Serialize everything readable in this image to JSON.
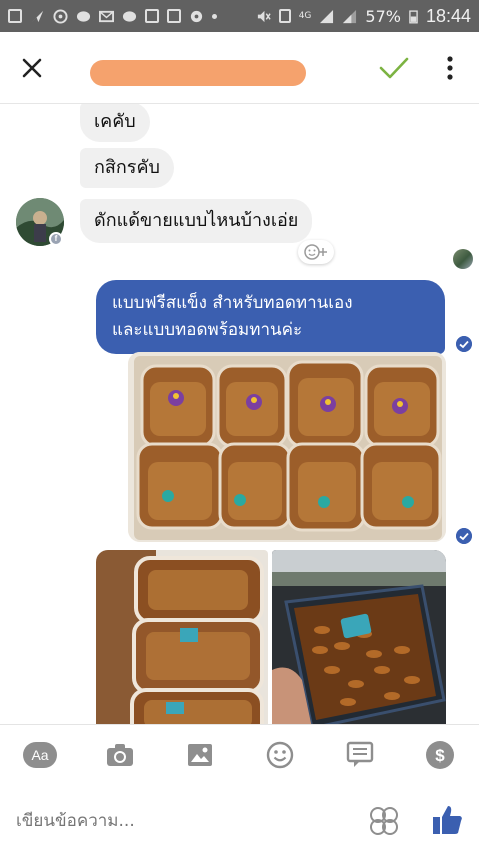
{
  "status_bar": {
    "battery": "57%",
    "time": "18:44",
    "network": "4G"
  },
  "header": {
    "close_icon": "close-icon",
    "confirm_icon": "check-icon",
    "more_icon": "more-vertical-icon"
  },
  "messages": {
    "in1": "เคคับ",
    "in2": "กสิกรคับ",
    "in3": "ดักแด้ขายแบบไหนบ้างเอ่ย",
    "out1_line1": "แบบฟรีสแข็ง สำหรับทอดทานเอง",
    "out1_line2": "และแบบทอดพร้อมทานค่ะ"
  },
  "composer": {
    "aa_label": "Aa",
    "placeholder": "เขียนข้อความ...",
    "tools": [
      "text-format-icon",
      "camera-icon",
      "image-icon",
      "emoji-icon",
      "message-icon",
      "payment-icon"
    ]
  },
  "colors": {
    "accent": "#3b5fb0",
    "confirm": "#7cb342",
    "incoming_bubble": "#f0f0f0",
    "status_bar": "#616161"
  }
}
